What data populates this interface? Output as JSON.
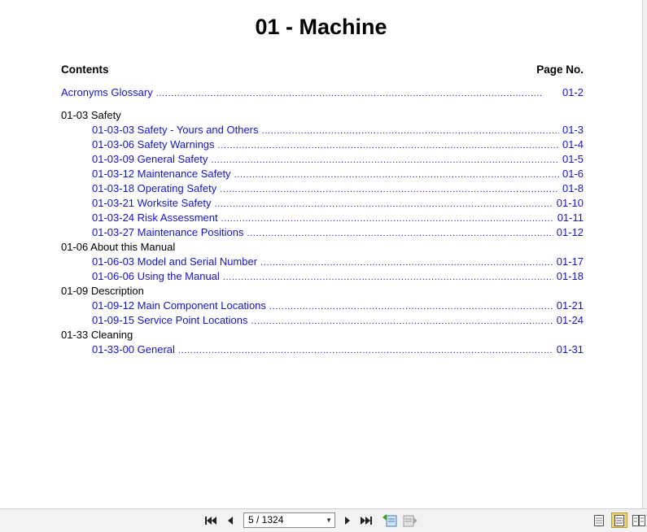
{
  "title": "01 - Machine",
  "header": {
    "contents": "Contents",
    "page_no": "Page No."
  },
  "toc": [
    {
      "kind": "top",
      "text": "Acronyms Glossary",
      "page": "01-2"
    },
    {
      "kind": "section",
      "text": "01-03 Safety"
    },
    {
      "kind": "entry",
      "text": "01-03-03 Safety - Yours and Others",
      "page": "01-3"
    },
    {
      "kind": "entry",
      "text": "01-03-06 Safety Warnings",
      "page": "01-4"
    },
    {
      "kind": "entry",
      "text": "01-03-09 General Safety",
      "page": "01-5"
    },
    {
      "kind": "entry",
      "text": "01-03-12 Maintenance Safety",
      "page": "01-6"
    },
    {
      "kind": "entry",
      "text": "01-03-18 Operating Safety",
      "page": "01-8"
    },
    {
      "kind": "entry",
      "text": "01-03-21 Worksite Safety",
      "page": "01-10"
    },
    {
      "kind": "entry",
      "text": "01-03-24 Risk Assessment",
      "page": "01-11"
    },
    {
      "kind": "entry",
      "text": "01-03-27 Maintenance Positions",
      "page": "01-12"
    },
    {
      "kind": "section",
      "text": "01-06 About this Manual"
    },
    {
      "kind": "entry",
      "text": "01-06-03 Model and Serial Number",
      "page": "01-17"
    },
    {
      "kind": "entry",
      "text": "01-06-06 Using the Manual",
      "page": "01-18"
    },
    {
      "kind": "section",
      "text": "01-09 Description"
    },
    {
      "kind": "entry",
      "text": "01-09-12 Main Component Locations",
      "page": "01-21"
    },
    {
      "kind": "entry",
      "text": "01-09-15 Service Point Locations",
      "page": "01-24"
    },
    {
      "kind": "section",
      "text": "01-33 Cleaning"
    },
    {
      "kind": "entry",
      "text": "01-33-00 General",
      "page": "01-31"
    }
  ],
  "toolbar": {
    "page_indicator": "5 / 1324",
    "icons": [
      "first-page-icon",
      "previous-page-icon",
      "next-page-icon",
      "last-page-icon",
      "go-back-icon",
      "go-forward-icon",
      "single-page-view-icon",
      "continuous-view-icon",
      "two-page-view-icon"
    ],
    "active_view": "continuous-view-icon"
  }
}
